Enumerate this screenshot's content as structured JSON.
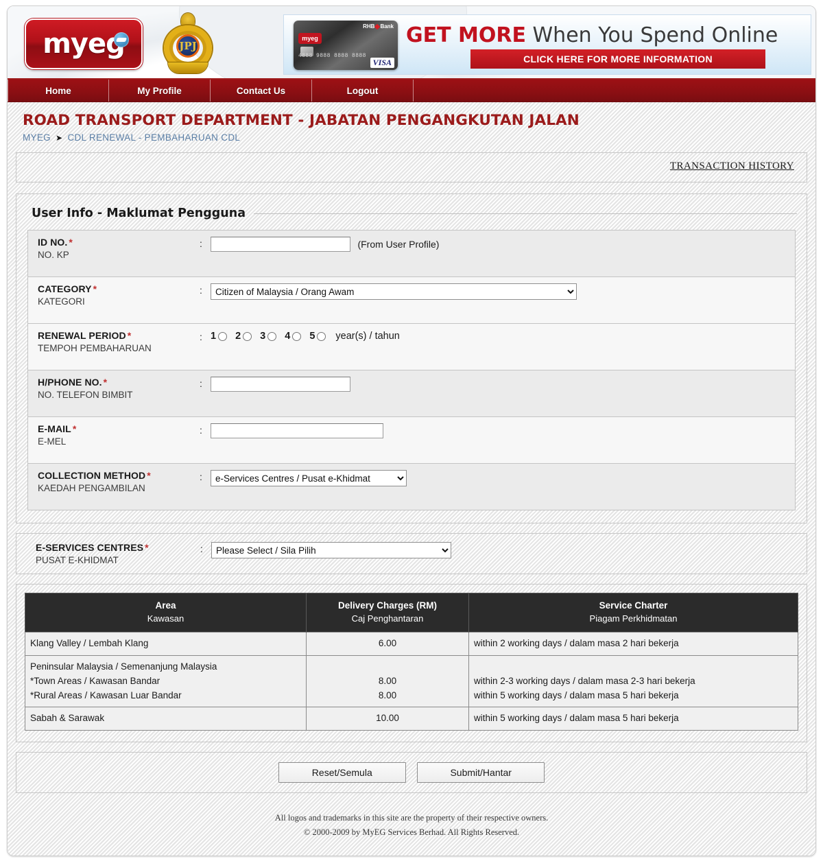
{
  "header": {
    "logo_text": "myeg",
    "emblem_name": "jpj-emblem",
    "banner": {
      "headline_bold": "GET MORE",
      "headline_rest": " When You Spend Online",
      "cta": "CLICK HERE FOR MORE INFORMATION",
      "card_bank": "RHB",
      "card_bank_suffix": "Bank",
      "card_logo": "myeg",
      "card_number": "4888 9888 8888 8888",
      "card_network": "VISA"
    }
  },
  "nav": {
    "items": [
      {
        "label": "Home"
      },
      {
        "label": "My Profile"
      },
      {
        "label": "Contact Us"
      },
      {
        "label": "Logout"
      }
    ]
  },
  "page": {
    "title": "ROAD TRANSPORT DEPARTMENT - JABATAN PENGANGKUTAN JALAN",
    "breadcrumb_root": "MYEG",
    "breadcrumb_arrow": "➤",
    "breadcrumb_current": "CDL RENEWAL - PEMBAHARUAN CDL",
    "transaction_history": "TRANSACTION HISTORY"
  },
  "form": {
    "section_title": "User Info - Maklumat Pengguna",
    "required_mark": "*",
    "colon": ":",
    "fields": {
      "id_no": {
        "label_en": "ID NO.",
        "label_ms": "NO. KP",
        "value": "",
        "hint": "(From User Profile)"
      },
      "category": {
        "label_en": "CATEGORY",
        "label_ms": "KATEGORI",
        "selected": "Citizen of Malaysia / Orang Awam"
      },
      "renewal_period": {
        "label_en": "RENEWAL PERIOD",
        "label_ms": "TEMPOH PEMBAHARUAN",
        "options": [
          "1",
          "2",
          "3",
          "4",
          "5"
        ],
        "suffix": "year(s) / tahun",
        "selected": null
      },
      "phone_no": {
        "label_en": "H/PHONE NO.",
        "label_ms": "NO. TELEFON BIMBIT",
        "value": ""
      },
      "email": {
        "label_en": "E-MAIL",
        "label_ms": "E-MEL",
        "value": ""
      },
      "collection_method": {
        "label_en": "COLLECTION METHOD",
        "label_ms": "KAEDAH PENGAMBILAN",
        "selected": "e-Services Centres / Pusat e-Khidmat"
      },
      "eservices_centres": {
        "label_en": "E-SERVICES CENTRES",
        "label_ms": "PUSAT E-KHIDMAT",
        "selected": "Please Select / Sila Pilih"
      }
    }
  },
  "charges_table": {
    "headers": [
      {
        "en": "Area",
        "ms": "Kawasan"
      },
      {
        "en": "Delivery Charges (RM)",
        "ms": "Caj Penghantaran"
      },
      {
        "en": "Service Charter",
        "ms": "Piagam Perkhidmatan"
      }
    ],
    "rows": [
      {
        "area_lines": [
          "Klang Valley / Lembah Klang"
        ],
        "charge_lines": [
          "6.00"
        ],
        "service_lines": [
          "within 2 working days / dalam masa 2 hari bekerja"
        ]
      },
      {
        "area_lines": [
          "Peninsular Malaysia / Semenanjung Malaysia",
          "*Town Areas / Kawasan Bandar",
          "*Rural Areas / Kawasan Luar Bandar"
        ],
        "charge_lines": [
          "",
          "8.00",
          "8.00"
        ],
        "service_lines": [
          "",
          "within 2-3 working days / dalam masa 2-3 hari bekerja",
          "within 5 working days / dalam masa 5 hari bekerja"
        ]
      },
      {
        "area_lines": [
          "Sabah & Sarawak"
        ],
        "charge_lines": [
          "10.00"
        ],
        "service_lines": [
          "within 5 working days / dalam masa 5 hari bekerja"
        ]
      }
    ]
  },
  "buttons": {
    "reset": "Reset/Semula",
    "submit": "Submit/Hantar"
  },
  "footer": {
    "line1": "All logos and trademarks in this site are the property of their respective owners.",
    "line2": "© 2000-2009 by MyEG Services Berhad. All Rights Reserved."
  },
  "colors": {
    "brand_red": "#9d1014",
    "title_red": "#9b1b1b",
    "breadcrumb_blue": "#5b7fa6",
    "required_red": "#c03030",
    "table_header_bg": "#2b2b2b"
  }
}
